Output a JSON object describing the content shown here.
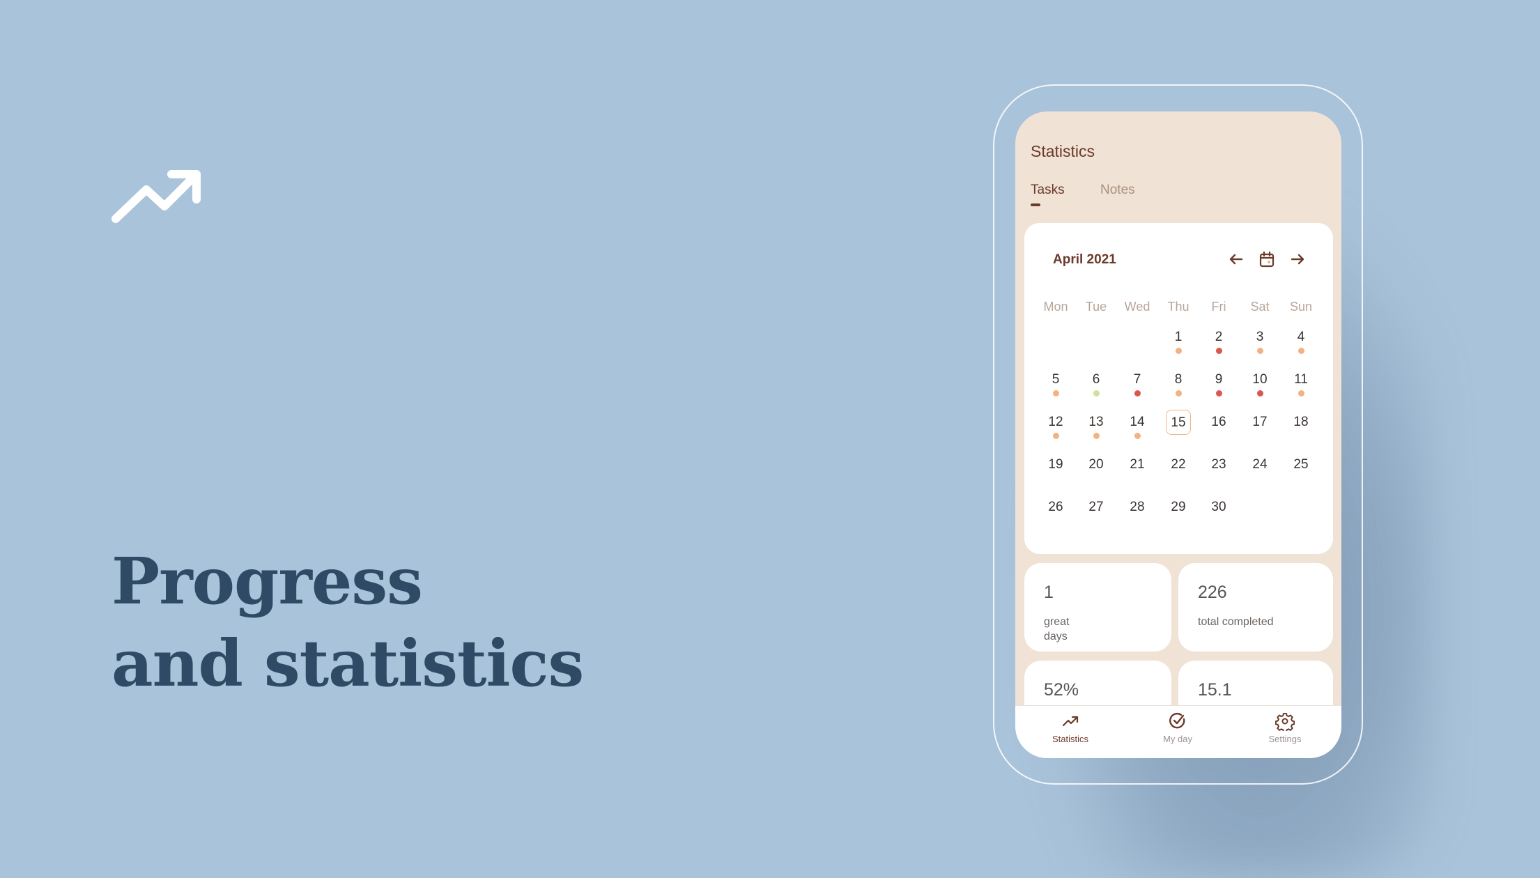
{
  "hero": {
    "icon": "trending-up-icon",
    "headline_line1": "Progress",
    "headline_line2": "and statistics"
  },
  "app": {
    "title": "Statistics",
    "tabs": [
      {
        "label": "Tasks",
        "active": true
      },
      {
        "label": "Notes",
        "active": false
      }
    ],
    "calendar": {
      "month_label": "April 2021",
      "prev_icon": "arrow-left-icon",
      "today_icon": "calendar-icon",
      "next_icon": "arrow-right-icon",
      "weekdays": [
        "Mon",
        "Tue",
        "Wed",
        "Thu",
        "Fri",
        "Sat",
        "Sun"
      ],
      "first_weekday_index": 3,
      "days_in_month": 30,
      "today": 15,
      "day_status": {
        "1": "partial",
        "2": "bad",
        "3": "partial",
        "4": "partial",
        "5": "partial",
        "6": "great",
        "7": "bad",
        "8": "partial",
        "9": "bad",
        "10": "bad",
        "11": "partial",
        "12": "partial",
        "13": "partial",
        "14": "partial"
      },
      "status_colors": {
        "great": "#cfe29a",
        "partial": "#f2b283",
        "bad": "#d9574f"
      }
    },
    "stats": [
      {
        "value": "1",
        "label": "great days"
      },
      {
        "value": "226",
        "label": "total completed"
      },
      {
        "value": "52%",
        "label": ""
      },
      {
        "value": "15.1",
        "label": ""
      }
    ],
    "bottom_nav": [
      {
        "label": "Statistics",
        "icon": "trending-up-icon",
        "active": true
      },
      {
        "label": "My day",
        "icon": "check-circle-icon",
        "active": false
      },
      {
        "label": "Settings",
        "icon": "gear-icon",
        "active": false
      }
    ],
    "colors": {
      "accent": "#6a3a2a",
      "screen_bg": "#f0e2d5",
      "page_bg": "#a9c3da",
      "headline": "#2f4a64",
      "muted": "#a8907f"
    }
  }
}
